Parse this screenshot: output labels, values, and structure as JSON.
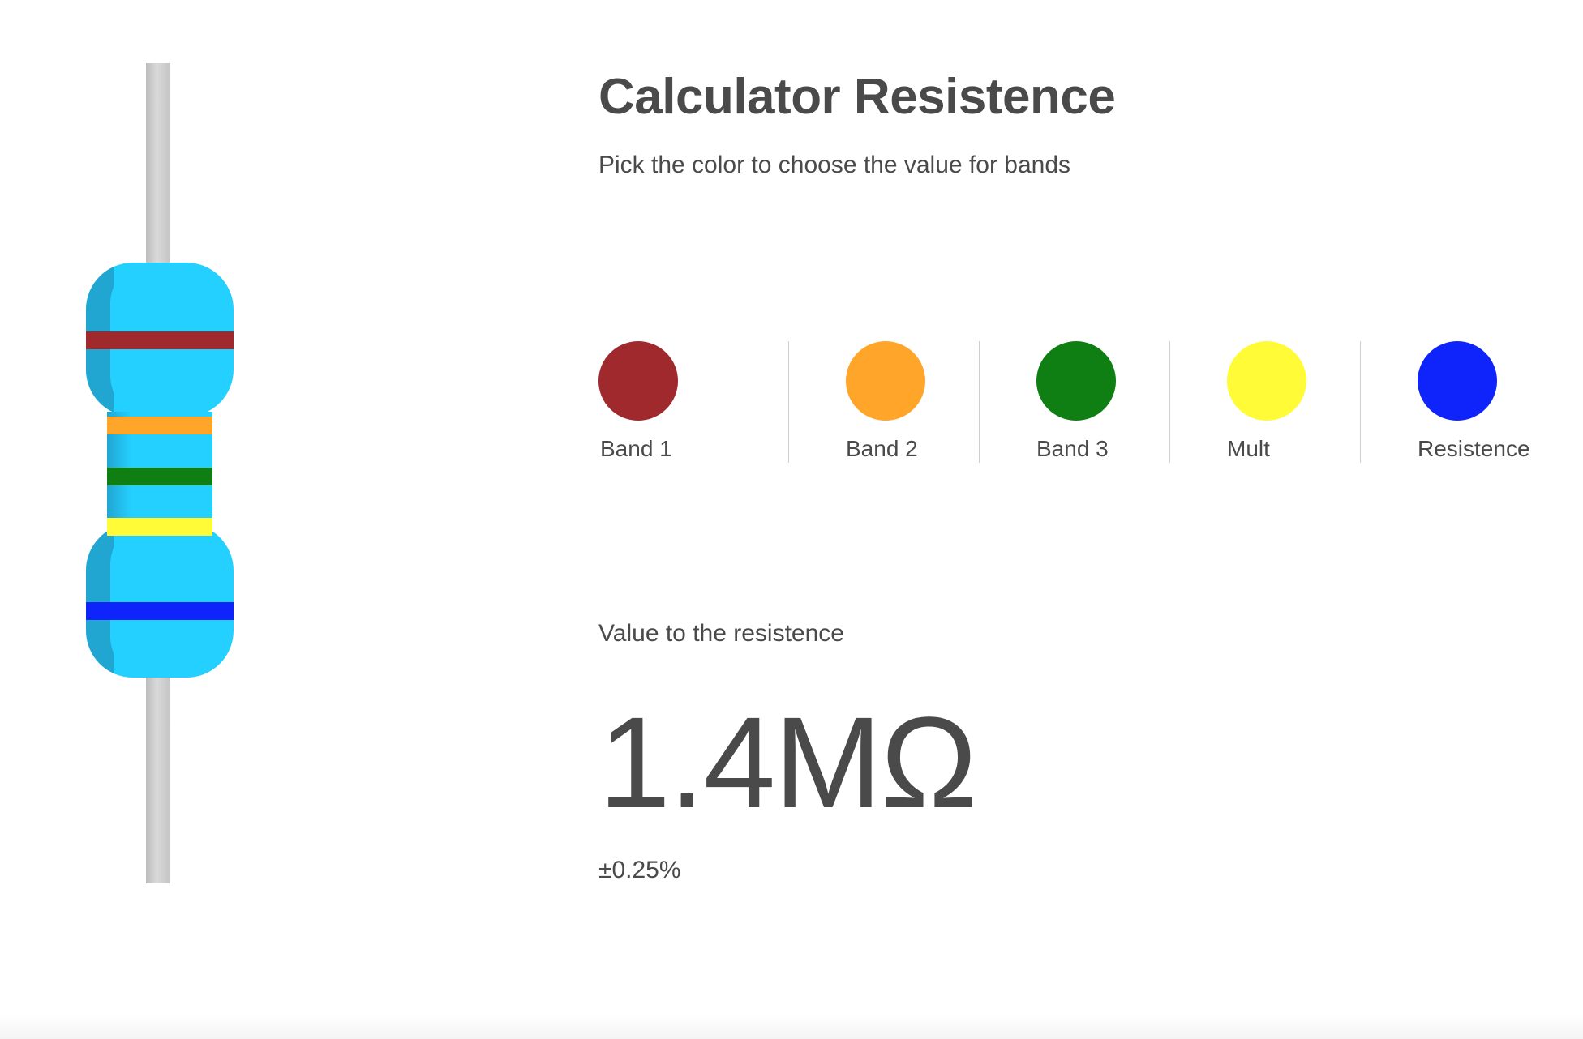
{
  "header": {
    "title": "Calculator Resistence",
    "subtitle": "Pick the color to choose the value for bands"
  },
  "bands": [
    {
      "label": "Band 1",
      "color": "#a0292d"
    },
    {
      "label": "Band 2",
      "color": "#ffa52a"
    },
    {
      "label": "Band 3",
      "color": "#0f7f13"
    },
    {
      "label": "Mult",
      "color": "#fffb36"
    },
    {
      "label": "Resistence",
      "color": "#0f23fb"
    }
  ],
  "resistor": {
    "body_color": "#24d0ff",
    "band_colors": [
      "#a0292d",
      "#ffa52a",
      "#0f7f13",
      "#fffb36",
      "#0f23fb"
    ]
  },
  "result": {
    "caption": "Value to the resistence",
    "value": "1.4MΩ",
    "tolerance": "±0.25%"
  }
}
